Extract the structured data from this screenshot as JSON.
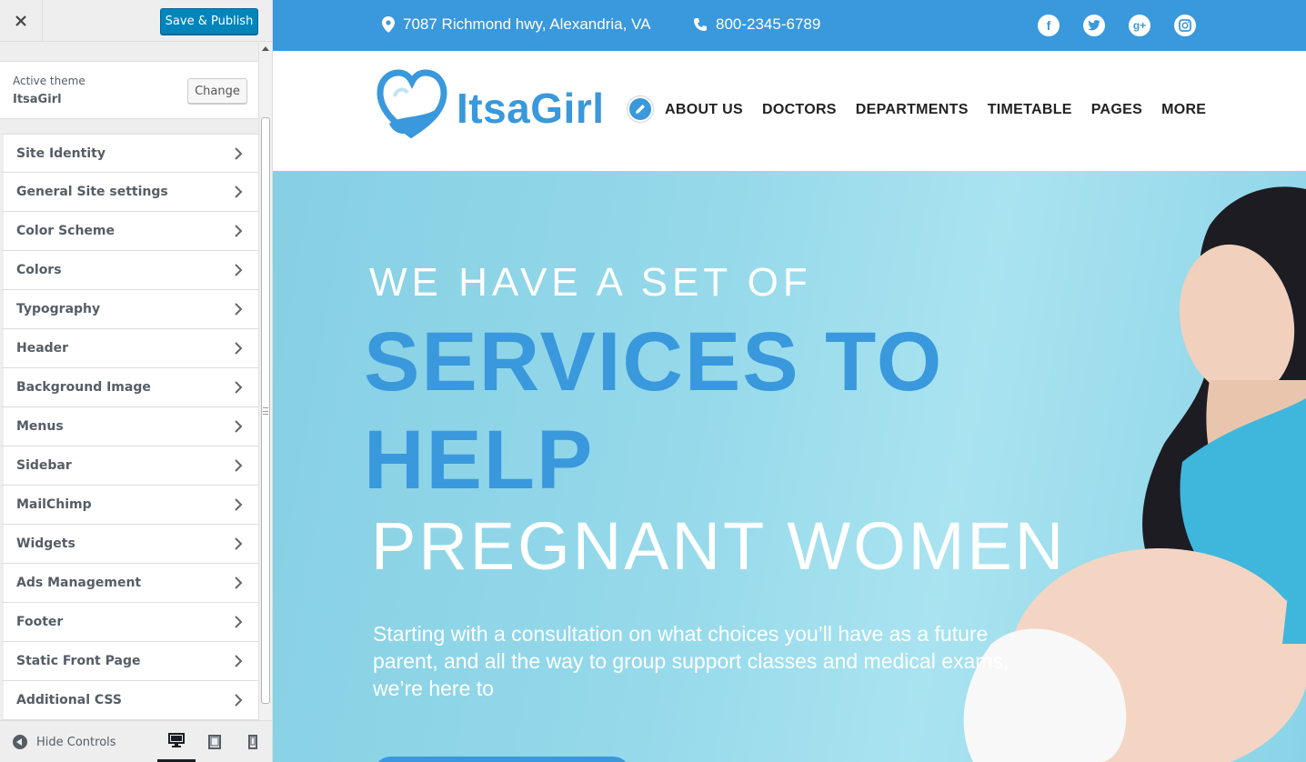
{
  "customizer": {
    "save_label": "Save & Publish",
    "theme_caption": "Active theme",
    "theme_name": "ItsaGirl",
    "change_label": "Change",
    "sections": [
      {
        "label": "Site Identity"
      },
      {
        "label": "General Site settings"
      },
      {
        "label": "Color Scheme"
      },
      {
        "label": "Colors"
      },
      {
        "label": "Typography"
      },
      {
        "label": "Header"
      },
      {
        "label": "Background Image"
      },
      {
        "label": "Menus"
      },
      {
        "label": "Sidebar"
      },
      {
        "label": "MailChimp"
      },
      {
        "label": "Widgets"
      },
      {
        "label": "Ads Management"
      },
      {
        "label": "Footer"
      },
      {
        "label": "Static Front Page"
      },
      {
        "label": "Additional CSS"
      }
    ],
    "hide_controls_label": "Hide Controls",
    "active_device": "desktop"
  },
  "site": {
    "address": "7087 Richmond hwy, Alexandria, VA",
    "phone": "800-2345-6789",
    "social_icons": [
      "facebook-icon",
      "twitter-icon",
      "google-plus-icon",
      "instagram-icon"
    ],
    "logo_text": "ItsaGirl",
    "nav": [
      "ABOUT US",
      "DOCTORS",
      "DEPARTMENTS",
      "TIMETABLE",
      "PAGES",
      "MORE"
    ],
    "hero": {
      "pre": "WE HAVE A SET OF",
      "main": "SERVICES TO HELP",
      "sub": "PREGNANT WOMEN",
      "desc": "Starting with a consultation on what choices you’ll have as a future parent, and all the way to group support classes and medical exams, we’re here to"
    }
  },
  "colors": {
    "brand_blue": "#3a98dc",
    "wp_primary": "#0085ba",
    "hero_bg": "#95d9ea"
  }
}
